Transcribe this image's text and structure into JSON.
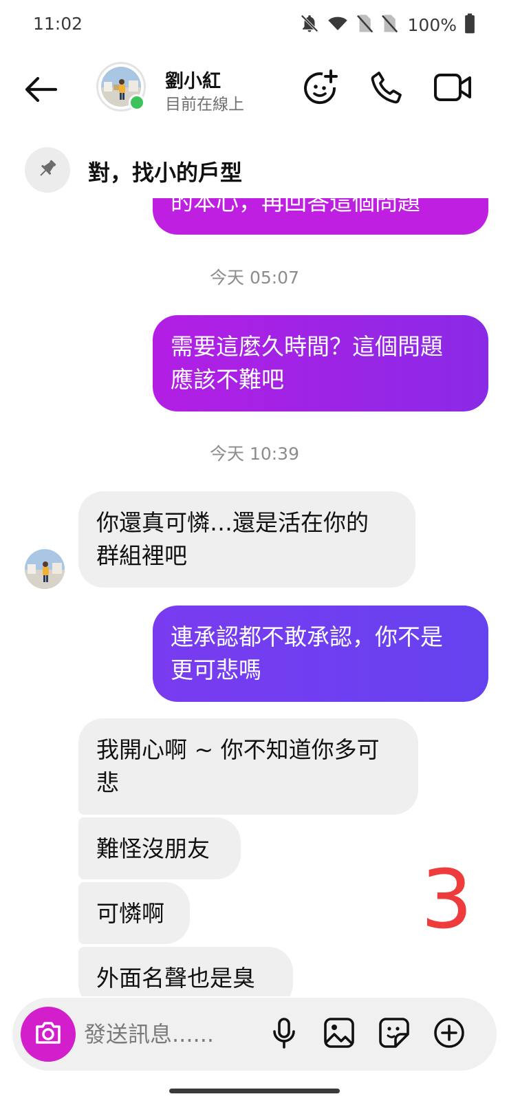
{
  "status_bar": {
    "time": "11:02",
    "battery": "100%",
    "icons": [
      "bell-off-icon",
      "wifi-icon",
      "no-sim-icon",
      "no-sim-icon",
      "battery-icon"
    ]
  },
  "header": {
    "contact_name": "劉小紅",
    "contact_status": "目前在線上",
    "online_color": "#3ec25c",
    "icons": [
      "back-arrow-icon",
      "emoji-add-icon",
      "phone-icon",
      "video-icon"
    ]
  },
  "pinned": {
    "icon": "pin-icon",
    "text": "對，找小的戶型"
  },
  "chat": {
    "partial_top_message": "的本心，再回答這個問題",
    "messages": [
      {
        "type": "timestamp",
        "text": "今天 05:07"
      },
      {
        "type": "outgoing",
        "lines": [
          "需要這麼久時間？這個問題",
          "應該不難吧"
        ],
        "color": "#9c25e5"
      },
      {
        "type": "timestamp",
        "text": "今天 10:39"
      },
      {
        "type": "incoming",
        "lines": [
          "你還真可憐…還是活在你的",
          "群組裡吧"
        ]
      },
      {
        "type": "outgoing",
        "lines": [
          "連承認都不敢承認，你不是",
          "更可悲嗎"
        ],
        "color": "#6a3ff0"
      },
      {
        "type": "incoming",
        "lines": [
          "我開心啊 ~ 你不知道你多可",
          "悲"
        ]
      },
      {
        "type": "incoming",
        "lines": [
          "難怪沒朋友"
        ]
      },
      {
        "type": "incoming",
        "lines": [
          "可憐啊"
        ]
      },
      {
        "type": "incoming",
        "lines": [
          "外面名聲也是臭"
        ]
      }
    ]
  },
  "overlay": {
    "number": "3",
    "color": "#ee3b3b"
  },
  "composer": {
    "placeholder": "發送訊息......",
    "camera_color": "#d21ecb",
    "icons": [
      "camera-icon",
      "microphone-icon",
      "image-icon",
      "sticker-icon",
      "plus-circle-icon"
    ]
  }
}
